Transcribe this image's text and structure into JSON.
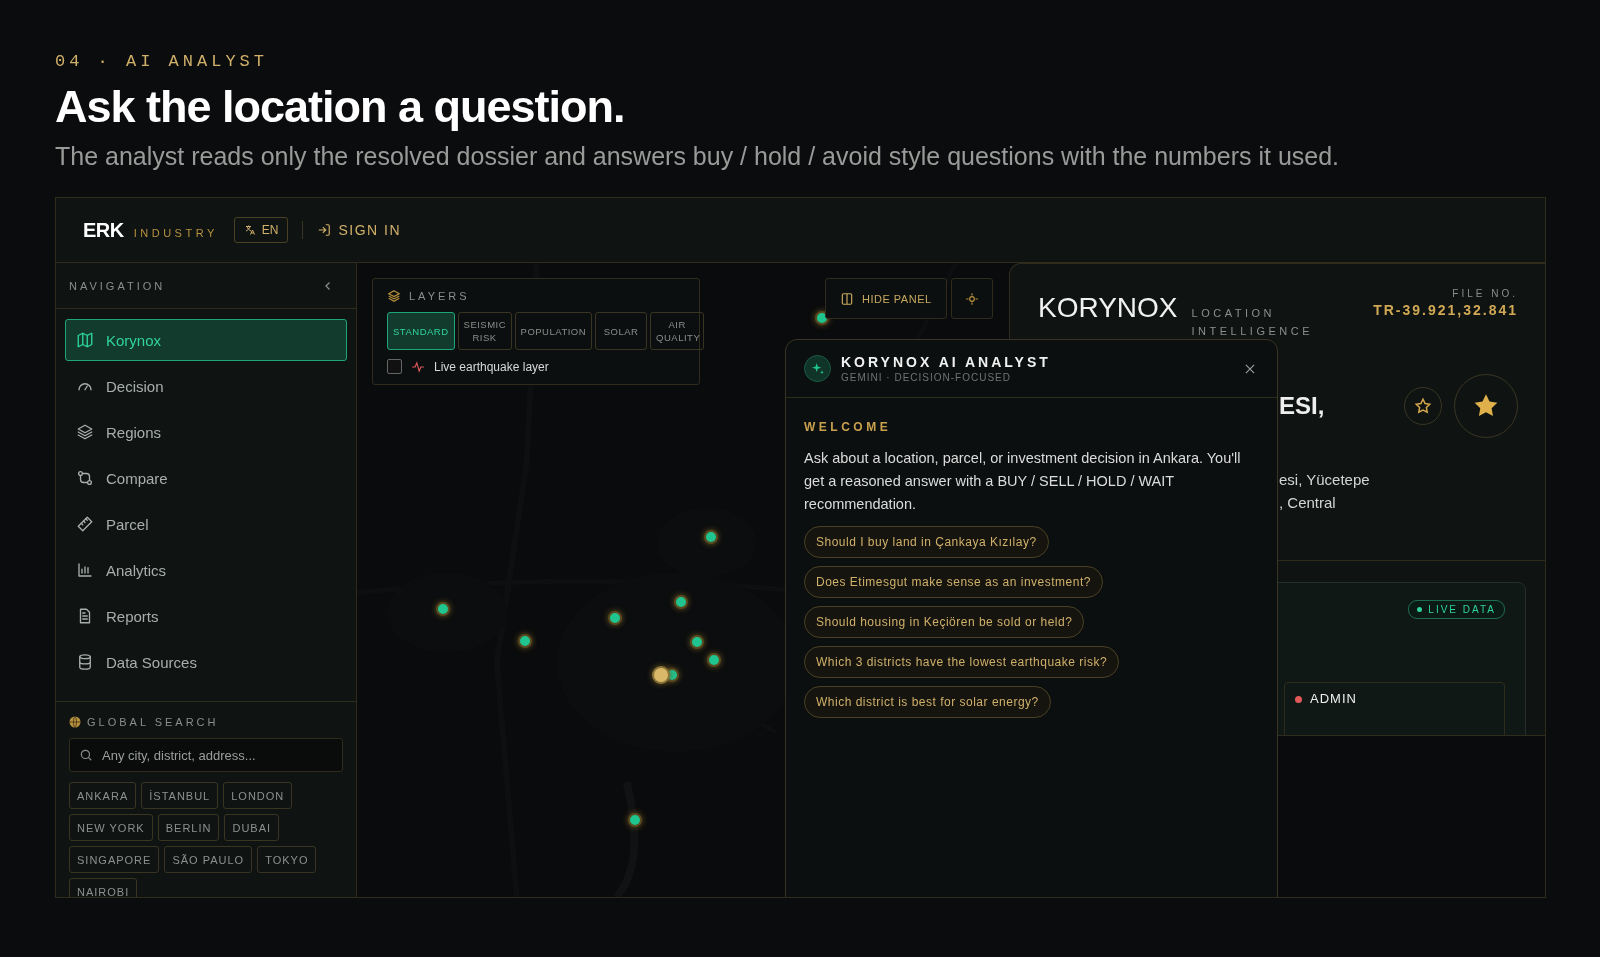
{
  "section": {
    "eyebrow": "04 · AI ANALYST",
    "title": "Ask the location a question.",
    "subtitle": "The analyst reads only the resolved dossier and answers buy / hold / avoid style questions with the numbers it used."
  },
  "topbar": {
    "brand": "ERK",
    "brand_suffix": "INDUSTRY",
    "language": "EN",
    "sign_in": "SIGN IN"
  },
  "sidebar": {
    "heading": "NAVIGATION",
    "items": [
      {
        "label": "Korynox",
        "selected": true
      },
      {
        "label": "Decision",
        "selected": false
      },
      {
        "label": "Regions",
        "selected": false
      },
      {
        "label": "Compare",
        "selected": false
      },
      {
        "label": "Parcel",
        "selected": false
      },
      {
        "label": "Analytics",
        "selected": false
      },
      {
        "label": "Reports",
        "selected": false
      },
      {
        "label": "Data Sources",
        "selected": false
      }
    ]
  },
  "global_search": {
    "heading": "GLOBAL SEARCH",
    "placeholder": "Any city, district, address...",
    "cities": [
      "ANKARA",
      "İSTANBUL",
      "LONDON",
      "NEW YORK",
      "BERLIN",
      "DUBAI",
      "SINGAPORE",
      "SÃO PAULO",
      "TOKYO",
      "NAIROBI"
    ]
  },
  "layers": {
    "heading": "LAYERS",
    "options": [
      {
        "label": "STANDARD",
        "selected": true
      },
      {
        "label": "SEISMIC RISK",
        "selected": false
      },
      {
        "label": "POPULATION",
        "selected": false
      },
      {
        "label": "SOLAR",
        "selected": false
      },
      {
        "label": "AIR QUALITY",
        "selected": false
      }
    ],
    "live_earthquake": {
      "label": "Live earthquake layer",
      "checked": false
    }
  },
  "map_controls": {
    "hide_panel": "HIDE PANEL"
  },
  "dossier": {
    "title": "KORYNOX",
    "subtitle": "LOCATION INTELLIGENCE",
    "file_label": "FILE NO.",
    "file_no": "TR-39.921,32.841",
    "heading_fragment": "ESI,",
    "address_lines": [
      "esi, Yücetepe",
      ", Central"
    ],
    "live_badge": "LIVE DATA",
    "layer_tag": {
      "label": "ADMIN",
      "color": "#e05a5a"
    }
  },
  "analyst": {
    "title": "KORYNOX AI ANALYST",
    "subtitle": "GEMINI · DECISION-FOCUSED",
    "welcome": "WELCOME",
    "message": "Ask about a location, parcel, or investment decision in Ankara. You'll get a reasoned answer with a BUY / SELL / HOLD / WAIT recommendation.",
    "suggestions": [
      "Should I buy land in Çankaya Kızılay?",
      "Does Etimesgut make sense as an investment?",
      "Should housing in Keçiören be sold or held?",
      "Which 3 districts have the lowest earthquake risk?",
      "Which district is best for solar energy?"
    ]
  }
}
